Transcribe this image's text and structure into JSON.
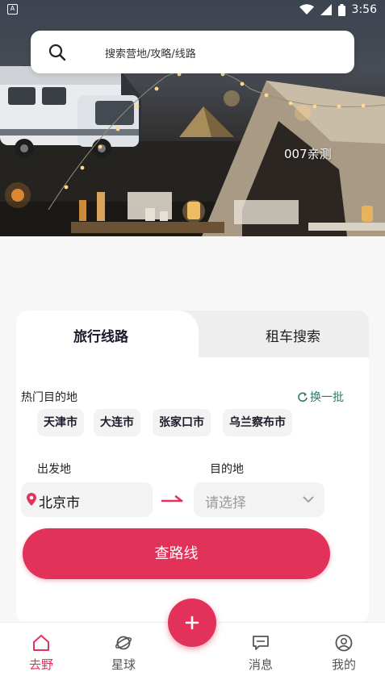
{
  "status_bar": {
    "time": "3:56",
    "left_icon": "android-a-icon",
    "icons": [
      "wifi-icon",
      "signal-icon",
      "battery-icon"
    ]
  },
  "search": {
    "placeholder": "搜索营地/攻略/线路",
    "icon": "search-icon"
  },
  "hero": {
    "caption": "007亲测"
  },
  "tabs": [
    {
      "label": "旅行线路",
      "active": true
    },
    {
      "label": "租车搜索",
      "active": false
    }
  ],
  "hot_destinations": {
    "title": "热门目的地",
    "refresh_label": "换一批",
    "items": [
      "天津市",
      "大连市",
      "张家口市",
      "乌兰察布市"
    ]
  },
  "route_form": {
    "from_label": "出发地",
    "from_value": "北京市",
    "to_label": "目的地",
    "to_placeholder": "请选择",
    "submit_label": "查路线"
  },
  "bottom_nav": [
    {
      "label": "去野",
      "icon": "home-icon",
      "active": true
    },
    {
      "label": "星球",
      "icon": "planet-icon",
      "active": false
    },
    {
      "label": "消息",
      "icon": "message-icon",
      "active": false
    },
    {
      "label": "我的",
      "icon": "profile-icon",
      "active": false
    }
  ],
  "fab": {
    "icon": "plus-icon"
  },
  "colors": {
    "accent": "#e3325a",
    "refresh": "#2b7a6b",
    "chip_bg": "#f3f3f3",
    "page_bg": "#f7f7f7"
  }
}
